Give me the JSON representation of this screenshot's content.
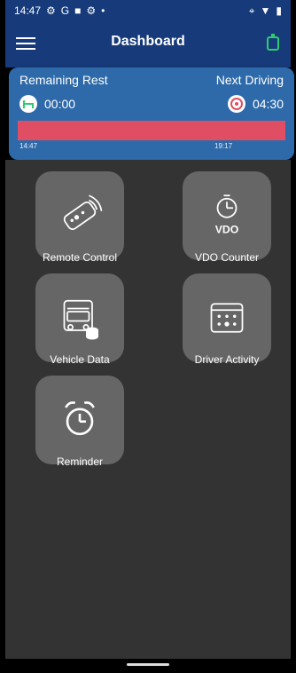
{
  "status": {
    "time": "14:47",
    "extra_icons": [
      "gear-icon",
      "google-icon",
      "square-icon",
      "settings-icon",
      "dot-icon"
    ],
    "right_icons": [
      "location-icon",
      "wifi-icon",
      "battery-icon"
    ]
  },
  "appbar": {
    "title": "Dashboard",
    "accent": "#2ecc71"
  },
  "summary": {
    "left_label": "Remaining Rest",
    "left_time": "00:00",
    "right_label": "Next Driving",
    "right_time": "04:30",
    "bar_fill_percent": 100,
    "tick_start": "14:47",
    "tick_end": "19:17"
  },
  "grid": {
    "items": [
      {
        "label": "Remote Control"
      },
      {
        "label": "VDO Counter"
      },
      {
        "label": "Vehicle Data"
      },
      {
        "label": "Driver Activity"
      },
      {
        "label": "Reminder"
      }
    ]
  }
}
